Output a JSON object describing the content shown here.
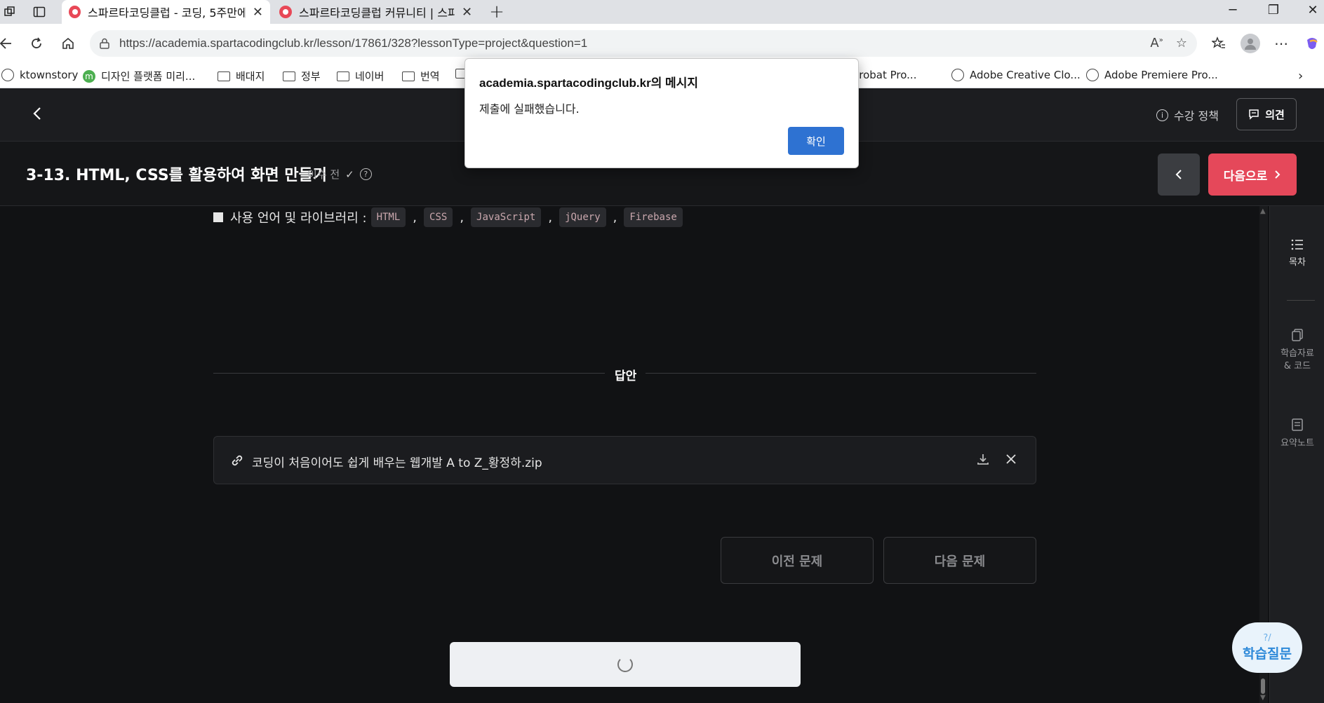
{
  "browser": {
    "tabs": [
      {
        "title": "스파르타코딩클럽 - 코딩, 5주만에",
        "active": true
      },
      {
        "title": "스파르타코딩클럽 커뮤니티 | 스파",
        "active": false
      }
    ],
    "new_tab": "+",
    "url": "https://academia.spartacodingclub.kr/lesson/17861/328?lessonType=project&question=1",
    "bookmarks": [
      {
        "label": "ktownstory",
        "icon": "globe-icon"
      },
      {
        "label": "디자인 플랫폼 미리...",
        "icon": "m-icon"
      },
      {
        "label": "배대지",
        "icon": "folder-icon"
      },
      {
        "label": "정부",
        "icon": "folder-icon"
      },
      {
        "label": "네이버",
        "icon": "folder-icon"
      },
      {
        "label": "번역",
        "icon": "folder-icon"
      },
      {
        "label": "e Acrobat Pro...",
        "icon": "globe-icon"
      },
      {
        "label": "Adobe Creative Clo...",
        "icon": "globe-icon"
      },
      {
        "label": "Adobe Premiere Pro...",
        "icon": "globe-icon"
      }
    ]
  },
  "header": {
    "policy_label": "수강 정책",
    "opinion_label": "의견"
  },
  "lesson": {
    "title": "3-13. HTML, CSS를 활용하여 화면 만들기",
    "status": "이수 전",
    "next_label": "다음으로"
  },
  "content": {
    "libraries_label": "사용 언어 및 라이브러리 :",
    "libraries": [
      "HTML",
      "CSS",
      "JavaScript",
      "jQuery",
      "Firebase"
    ],
    "answer_label": "답안",
    "file_name": "코딩이 처음이어도 쉽게 배우는 웹개발 A to Z_황정하.zip",
    "prev_question": "이전 문제",
    "next_question": "다음 문제"
  },
  "sidebar": {
    "toc_label": "목차",
    "materials_label": "학습자료\n& 코드",
    "notes_label": "요약노트",
    "help_label": "학습질문",
    "help_mark": "?/"
  },
  "dialog": {
    "title": "academia.spartacodingclub.kr의 메시지",
    "message": "제출에 실패했습니다.",
    "ok_label": "확인"
  },
  "colors": {
    "accent_red": "#e5485a",
    "dialog_button_blue": "#2e72d2",
    "page_bg": "#111214"
  }
}
